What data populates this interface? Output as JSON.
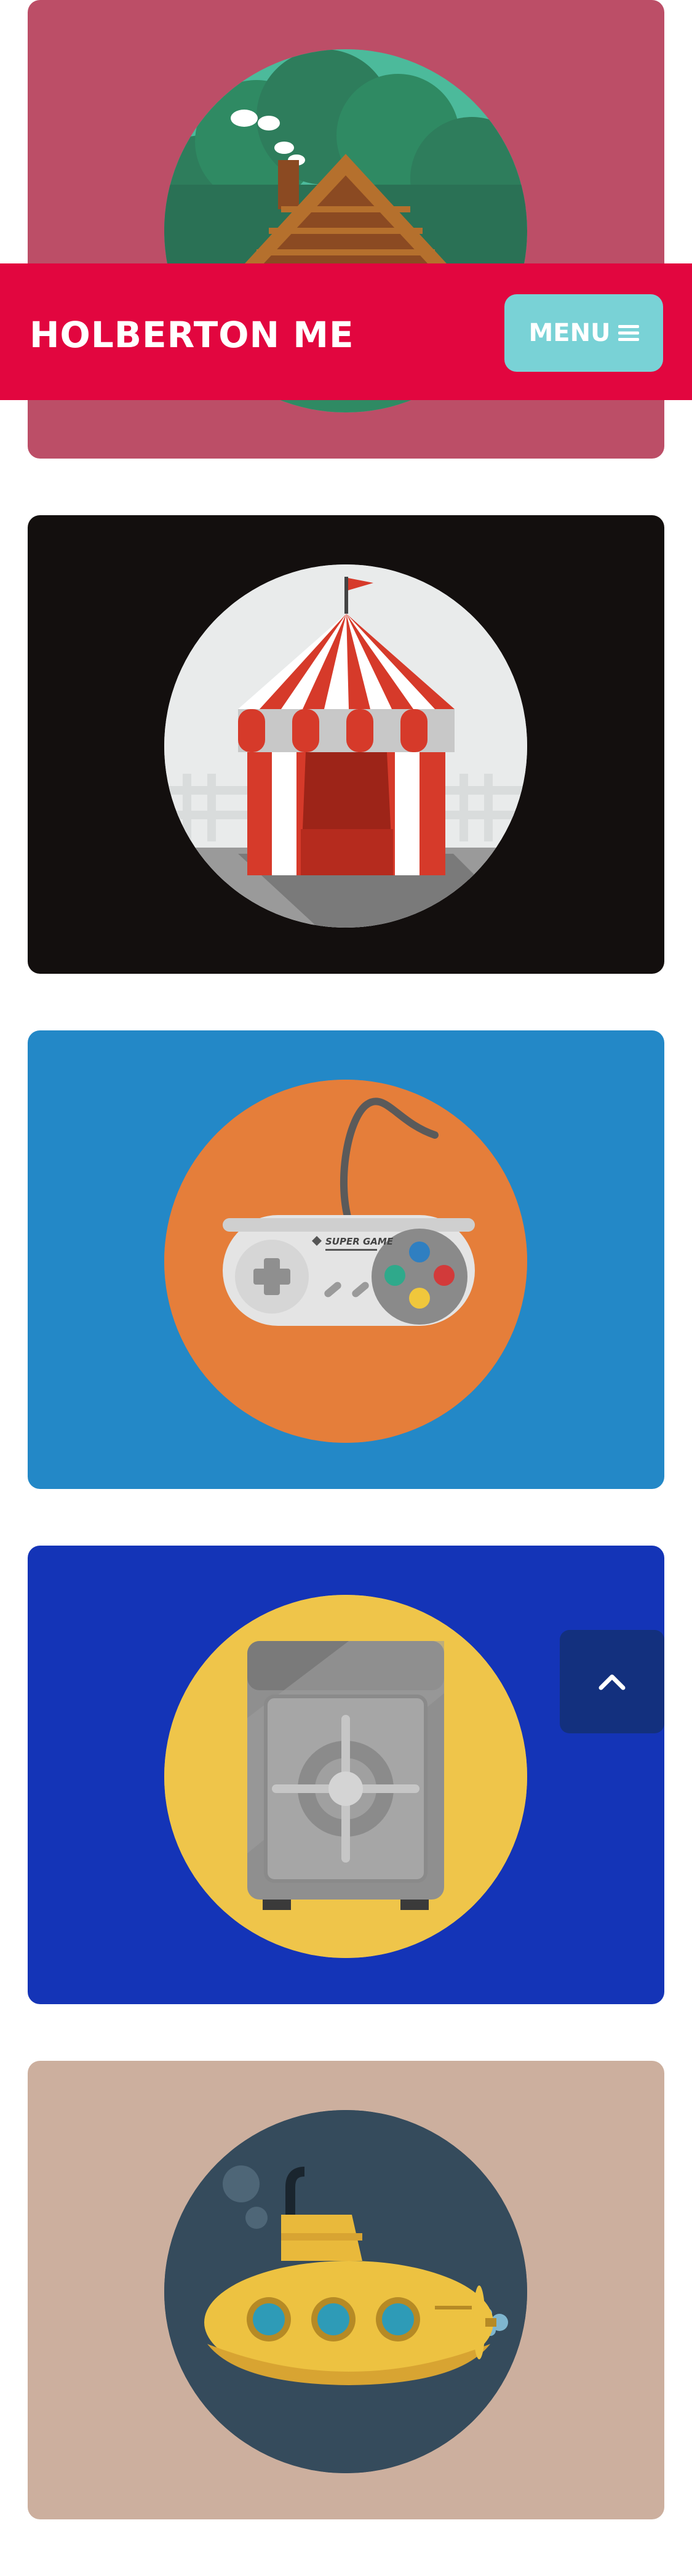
{
  "header": {
    "brand": "HOLBERTON ME",
    "menu_label": "MENU",
    "menu_icon": "hamburger-icon",
    "background": "#e2063f",
    "menu_color": "#79d2d6"
  },
  "cards": [
    {
      "name": "cabin-card",
      "illustration": "cabin-in-forest",
      "background": "#bc4e67",
      "circle": "#4cba9b"
    },
    {
      "name": "circus-card",
      "illustration": "circus-tent",
      "background": "#130f0e",
      "circle": "#e9ebeb"
    },
    {
      "name": "gamepad-card",
      "illustration": "gamepad",
      "background": "#2388c7",
      "circle": "#e57e3a",
      "gamepad_text": "SUPER GAME"
    },
    {
      "name": "safe-card",
      "illustration": "safe",
      "background": "#1434b7",
      "circle": "#efc54a"
    },
    {
      "name": "submarine-card",
      "illustration": "submarine",
      "background": "#ccaf9e",
      "circle": "#354b5c"
    }
  ],
  "scroll_top": {
    "icon": "chevron-up-icon",
    "background": "#13307e"
  }
}
